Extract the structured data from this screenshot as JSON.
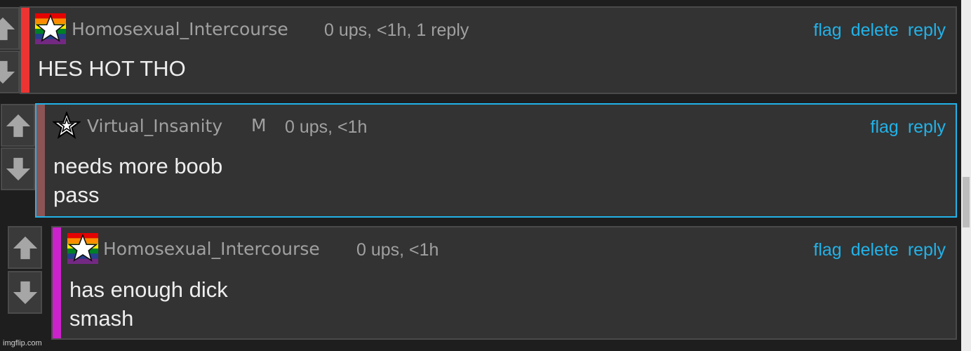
{
  "comments": [
    {
      "username": "Homosexual_Intercourse",
      "badge": "",
      "meta": "0 ups, <1h, 1 reply",
      "actions": [
        "flag",
        "delete",
        "reply"
      ],
      "lines": [
        "HES HOT THO"
      ],
      "bar_color": "#ee3333",
      "avatar": "rainbow-star"
    },
    {
      "username": "Virtual_Insanity",
      "badge": "M",
      "meta": "0 ups, <1h",
      "actions": [
        "flag",
        "reply"
      ],
      "lines": [
        "needs more boob",
        "pass"
      ],
      "bar_color": "#8c5454",
      "avatar": "outline-star"
    },
    {
      "username": "Homosexual_Intercourse",
      "badge": "",
      "meta": "0 ups, <1h",
      "actions": [
        "flag",
        "delete",
        "reply"
      ],
      "lines": [
        "has enough dick",
        "smash"
      ],
      "bar_color": "#cc22cc",
      "avatar": "rainbow-star"
    }
  ],
  "watermark": "imgflip.com",
  "colors": {
    "background": "#1e1e1e",
    "panel": "#333333",
    "link": "#22b2e8",
    "selected_border": "#22b2e8"
  },
  "icons": [
    "upvote-arrow-icon",
    "downvote-arrow-icon",
    "rainbow-star-icon",
    "outline-star-icon"
  ]
}
